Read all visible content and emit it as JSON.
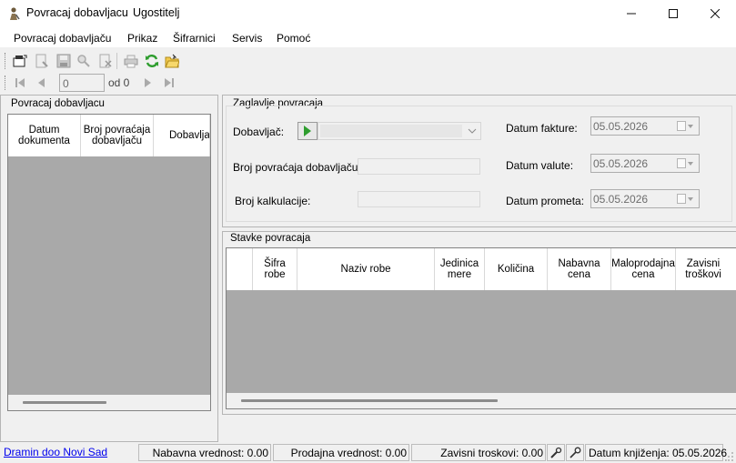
{
  "window": {
    "title": "Povracaj dobavljacu",
    "subtitle": "Ugostitelj",
    "icon": "app-icon",
    "buttons": [
      "minimize-icon",
      "maximize-icon",
      "close-icon"
    ]
  },
  "menu": {
    "items": [
      "Povracaj dobavljaču",
      "Prikaz",
      "Šifrarnici",
      "Servis",
      "Pomoć"
    ]
  },
  "toolbar": {
    "icons": [
      "new-document-icon",
      "edit-document-icon",
      "save-icon",
      "find-icon",
      "delete-icon",
      "print-icon",
      "refresh-icon",
      "open-folder-icon"
    ]
  },
  "navigator": {
    "position": "0",
    "of_label": "od 0"
  },
  "left_panel": {
    "title": "Povracaj dobavljacu",
    "columns": [
      "Datum dokumenta",
      "Broj povraćaja dobavljaču",
      "Dobavljač"
    ]
  },
  "header_panel": {
    "title": "Zaglavlje povracaja",
    "supplier_label": "Dobavljač:",
    "return_no_label": "Broj povraćaja dobavljaču:",
    "calc_no_label": "Broj kalkulacije:",
    "invoice_date_label": "Datum fakture:",
    "invoice_date": "05.05.2026",
    "value_date_label": "Datum valute:",
    "value_date": "05.05.2026",
    "turnover_date_label": "Datum prometa:",
    "turnover_date": "05.05.2026"
  },
  "items_panel": {
    "title": "Stavke povracaja",
    "columns": [
      "",
      "Šifra robe",
      "Naziv robe",
      "Jedinica mere",
      "Količina",
      "Nabavna cena",
      "Maloprodajna cena",
      "Zavisni troškovi"
    ]
  },
  "status": {
    "company": "Dramin doo Novi Sad",
    "purchase_value": "Nabavna vrednost: 0.00",
    "sales_value": "Prodajna vrednost: 0.00",
    "dependent_costs": "Zavisni troskovi: 0.00",
    "booking_date": "Datum knjiženja: 05.05.2026"
  },
  "colors": {
    "grid_background": "#a9a9a9",
    "link": "#0000ee",
    "accent_green": "#2e9d2e"
  }
}
